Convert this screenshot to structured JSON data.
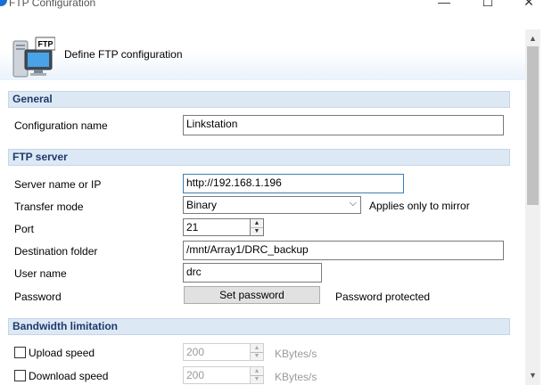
{
  "window": {
    "title": "FTP Configuration",
    "minimize_glyph": "—",
    "maximize_glyph": "☐",
    "close_glyph": "✕"
  },
  "header": {
    "text": "Define FTP configuration",
    "icon_label": "FTP",
    "icon": "ftp-computer-icon"
  },
  "sections": {
    "general": "General",
    "ftp_server": "FTP server",
    "bandwidth": "Bandwidth limitation"
  },
  "general": {
    "config_name_label": "Configuration name",
    "config_name_value": "Linkstation"
  },
  "ftp_server": {
    "server_label": "Server name or IP",
    "server_value": "http://192.168.1.196",
    "transfer_label": "Transfer mode",
    "transfer_value": "Binary",
    "transfer_note": "Applies only to mirror",
    "port_label": "Port",
    "port_value": "21",
    "dest_label": "Destination folder",
    "dest_value": "/mnt/Array1/DRC_backup",
    "user_label": "User name",
    "user_value": "drc",
    "password_label": "Password",
    "set_password_button": "Set password",
    "password_status": "Password protected"
  },
  "bandwidth": {
    "upload_label": "Upload speed",
    "upload_value": "200",
    "upload_unit": "KBytes/s",
    "download_label": "Download speed",
    "download_value": "200",
    "download_unit": "KBytes/s"
  },
  "colors": {
    "section_bg": "#dde8f5",
    "section_text": "#1f3a6a",
    "focus_border": "#3c7fb1"
  }
}
